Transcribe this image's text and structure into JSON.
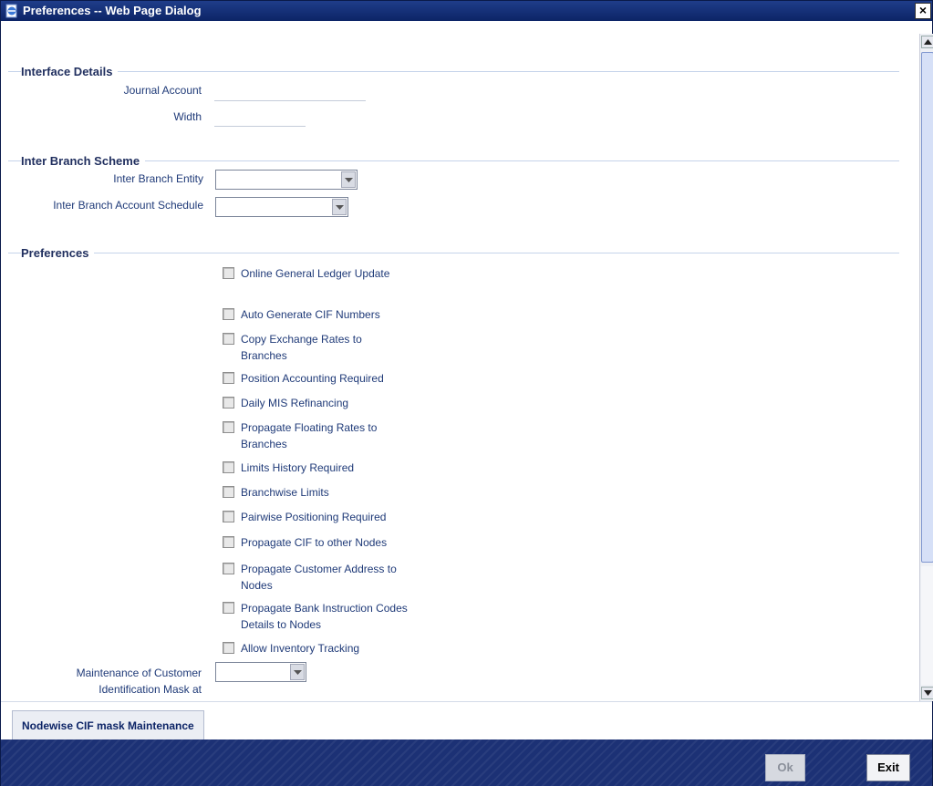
{
  "window": {
    "title": "Preferences -- Web Page Dialog",
    "close_label": "×"
  },
  "sections": {
    "interface_details": "Interface Details",
    "inter_branch_scheme": "Inter Branch Scheme",
    "preferences": "Preferences"
  },
  "interface_details": {
    "journal_account_label": "Journal Account",
    "journal_account_value": "",
    "width_label": "Width",
    "width_value": ""
  },
  "inter_branch": {
    "entity_label": "Inter Branch Entity",
    "entity_value": "",
    "account_schedule_label": "Inter Branch Account Schedule",
    "account_schedule_value": ""
  },
  "preferences": {
    "checkboxes": [
      {
        "label": "Online General Ledger Update",
        "checked": false
      },
      {
        "label": "Auto Generate CIF Numbers",
        "checked": false
      },
      {
        "label": "Copy Exchange Rates to Branches",
        "checked": false
      },
      {
        "label": "Position Accounting Required",
        "checked": false
      },
      {
        "label": "Daily MIS Refinancing",
        "checked": false
      },
      {
        "label": "Propagate Floating Rates to Branches",
        "checked": false
      },
      {
        "label": "Limits History Required",
        "checked": false
      },
      {
        "label": "Branchwise Limits",
        "checked": false
      },
      {
        "label": "Pairwise Positioning Required",
        "checked": false
      },
      {
        "label": "Propagate CIF to other Nodes",
        "checked": false
      },
      {
        "label": "Propagate Customer Address to Nodes",
        "checked": false
      },
      {
        "label": "Propagate Bank Instruction Codes Details to Nodes",
        "checked": false
      },
      {
        "label": "Allow Inventory Tracking",
        "checked": false
      }
    ],
    "mask_label_line1": "Maintenance of Customer",
    "mask_label_line2": "Identification Mask at",
    "mask_value": ""
  },
  "buttons": {
    "nodewise_cif": "Nodewise CIF mask Maintenance",
    "ok": "Ok",
    "exit": "Exit"
  },
  "colors": {
    "title_bar": "#1f3d8a",
    "footer": "#1c3175",
    "label_text": "#1f3a78"
  }
}
